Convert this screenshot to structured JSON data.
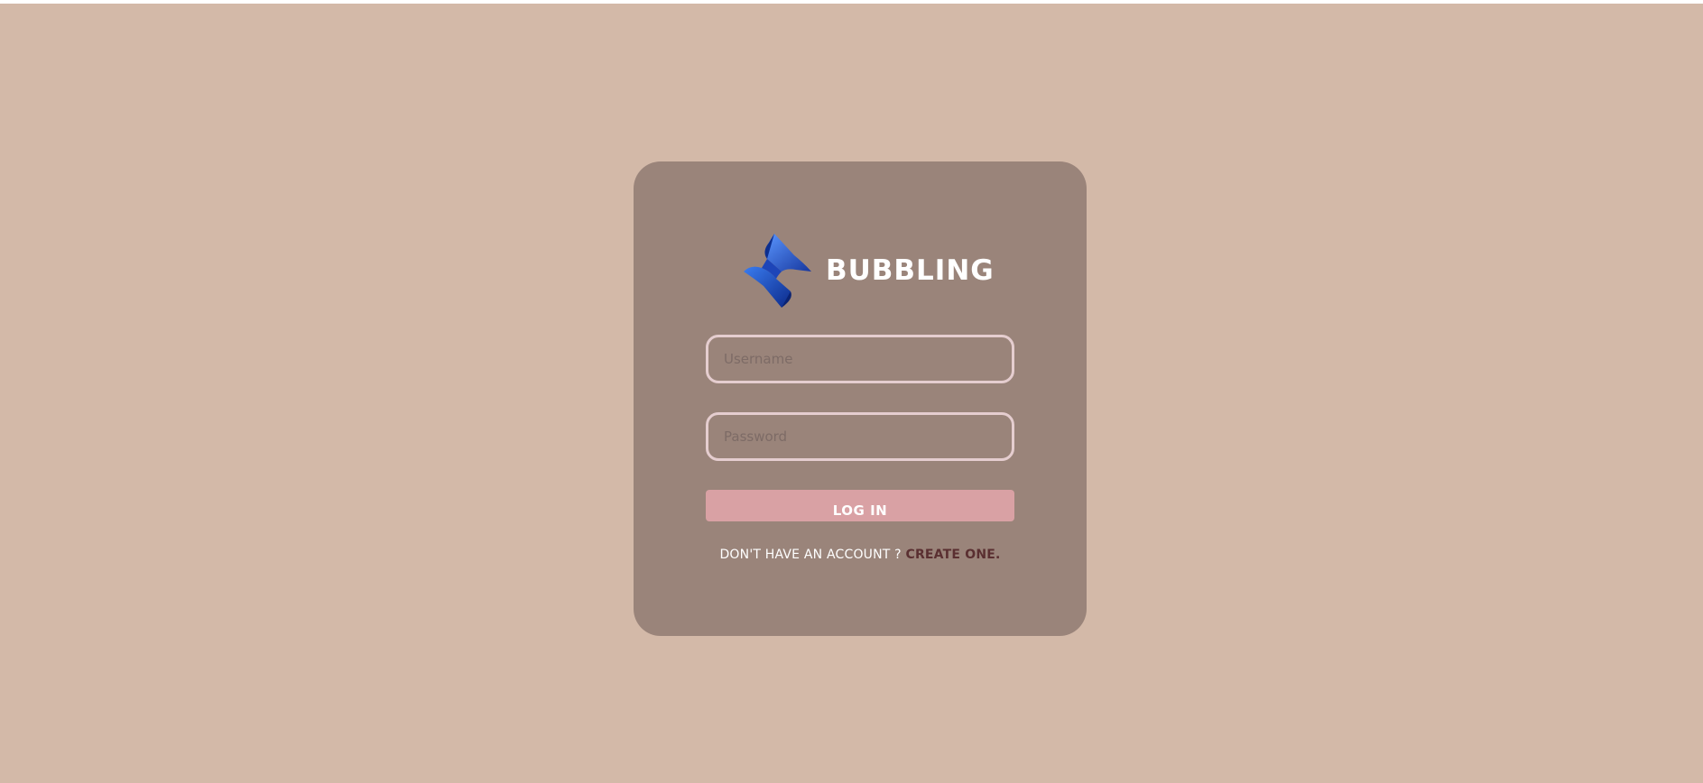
{
  "brand": {
    "name": "BUBBLING",
    "logo_icon": "blue-ribbon-diamond-logo",
    "logo_color": "#1f4fc7"
  },
  "login_form": {
    "username_placeholder": "Username",
    "password_placeholder": "Password",
    "submit_label": "LOG IN"
  },
  "signup": {
    "prompt": "DON'T HAVE AN ACCOUNT ? ",
    "link_label": "CREATE ONE."
  },
  "colors": {
    "page_background": "#d3b9a8",
    "card_background": "#9a847a",
    "field_border": "#e5cdcf",
    "button_background": "#d9a1a4",
    "link_color": "#5a2f31"
  }
}
